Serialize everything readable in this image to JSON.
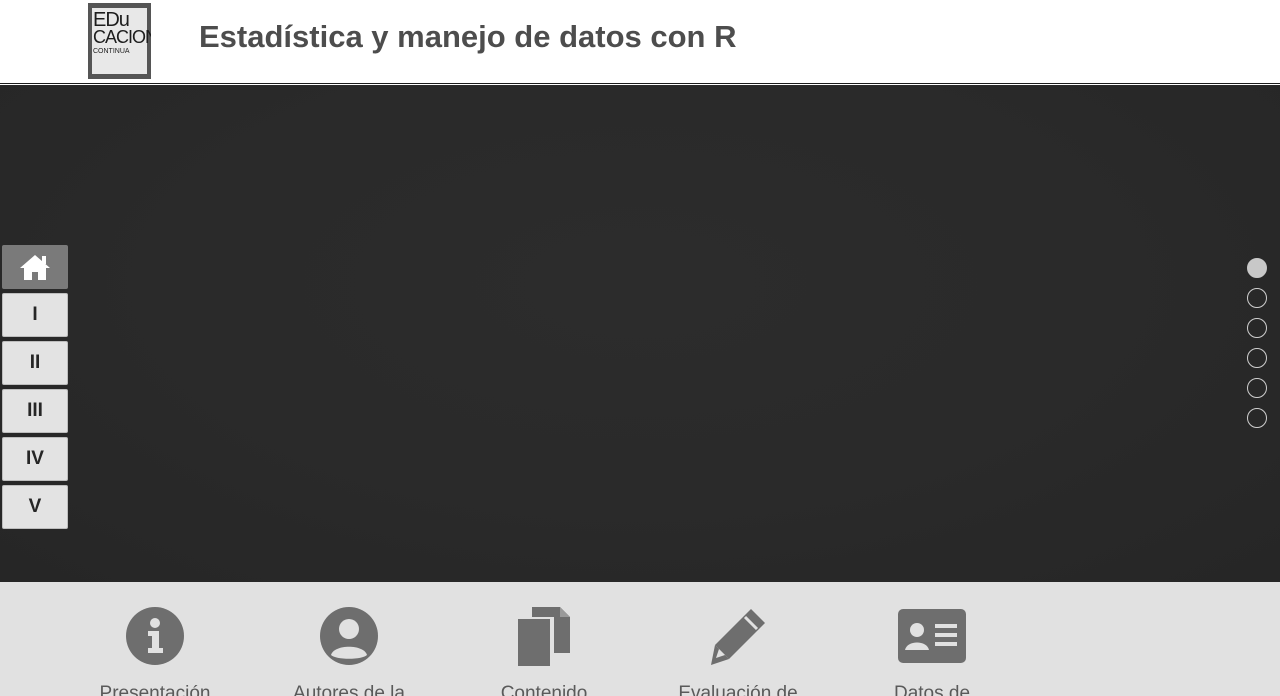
{
  "header": {
    "logo": {
      "line1": "EDu",
      "line2": "CACION",
      "line3": "CONTINUA",
      "icon": "educacion-continua-logo"
    },
    "title": "Estadística y manejo de datos con R"
  },
  "section_nav": {
    "home_icon": "home-icon",
    "items": [
      {
        "label": "I"
      },
      {
        "label": "II"
      },
      {
        "label": "III"
      },
      {
        "label": "IV"
      },
      {
        "label": "V"
      }
    ]
  },
  "slider": {
    "dot_count": 6,
    "active_index": 0
  },
  "features": [
    {
      "label": "Presentación",
      "icon": "info-icon"
    },
    {
      "label": "Autores de la",
      "icon": "user-icon"
    },
    {
      "label": "Contenido",
      "icon": "documents-icon"
    },
    {
      "label": "Evaluación de",
      "icon": "pencil-icon"
    },
    {
      "label": "Datos de",
      "icon": "id-card-icon"
    }
  ],
  "colors": {
    "hero_bg": "#2a2a2a",
    "feature_bar_bg": "#e1e1e1",
    "icon_gray": "#6e6e6e",
    "title_gray": "#4d4d4d"
  }
}
